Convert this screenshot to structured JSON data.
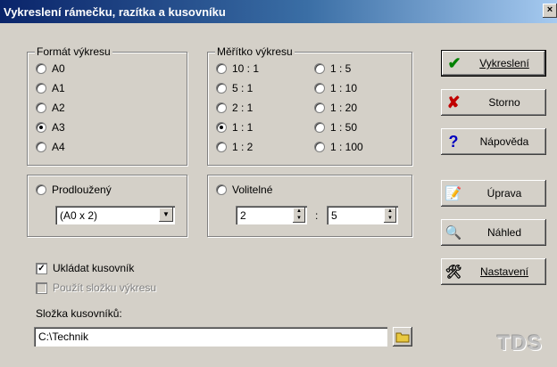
{
  "window": {
    "title": "Vykreslení rámečku, razítka a kusovníku",
    "close_glyph": "×"
  },
  "format": {
    "label": "Formát výkresu",
    "options": [
      {
        "label": "A0",
        "selected": false
      },
      {
        "label": "A1",
        "selected": false
      },
      {
        "label": "A2",
        "selected": false
      },
      {
        "label": "A3",
        "selected": true
      },
      {
        "label": "A4",
        "selected": false
      }
    ]
  },
  "scale": {
    "label": "Měřítko výkresu",
    "options": [
      {
        "label": "10 : 1",
        "selected": false
      },
      {
        "label": "1 : 5",
        "selected": false
      },
      {
        "label": "5 : 1",
        "selected": false
      },
      {
        "label": "1 : 10",
        "selected": false
      },
      {
        "label": "2 : 1",
        "selected": false
      },
      {
        "label": "1 : 20",
        "selected": false
      },
      {
        "label": "1 : 1",
        "selected": true
      },
      {
        "label": "1 : 50",
        "selected": false
      },
      {
        "label": "1 : 2",
        "selected": false
      },
      {
        "label": "1 : 100",
        "selected": false
      }
    ]
  },
  "extended": {
    "label": "Prodloužený",
    "selected": false,
    "combo_value": "(A0 x 2)"
  },
  "custom": {
    "label": "Volitelné",
    "selected": false,
    "value1": "2",
    "separator": ":",
    "value2": "5"
  },
  "bom": {
    "save_label": "Ukládat kusovník",
    "save_checked": true,
    "use_folder_label": "Použít složku výkresu",
    "use_folder_checked": false,
    "folder_label": "Složka kusovníků:",
    "folder_value": "C:\\Technik"
  },
  "buttons": {
    "draw": "Vykreslení",
    "cancel": "Storno",
    "help": "Nápověda",
    "edit": "Úprava",
    "preview": "Náhled",
    "settings": "Nastavení"
  },
  "logo": "TDS",
  "colors": {
    "draw_icon": "#008000",
    "cancel_icon": "#c00000",
    "help_icon": "#0000c0"
  }
}
